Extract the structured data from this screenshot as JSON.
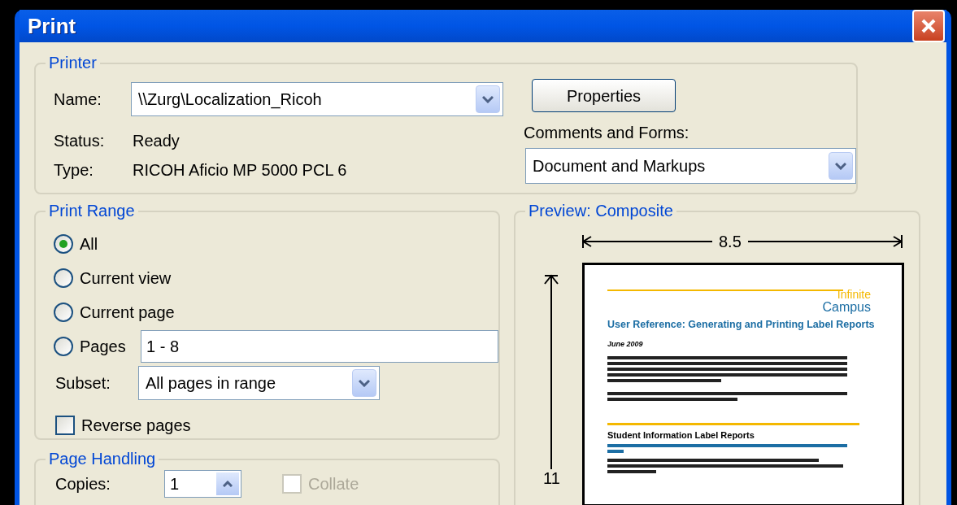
{
  "window": {
    "title": "Print"
  },
  "printer": {
    "legend": "Printer",
    "name_label": "Name:",
    "name_value": "\\\\Zurg\\Localization_Ricoh",
    "status_label": "Status:",
    "status_value": "Ready",
    "type_label": "Type:",
    "type_value": "RICOH Aficio MP 5000 PCL 6",
    "properties_button": "Properties",
    "comments_label": "Comments and Forms:",
    "comments_value": "Document and Markups"
  },
  "print_range": {
    "legend": "Print Range",
    "options": [
      {
        "label": "All",
        "selected": true
      },
      {
        "label": "Current view",
        "selected": false
      },
      {
        "label": "Current page",
        "selected": false
      },
      {
        "label": "Pages",
        "selected": false,
        "value": "1 - 8"
      }
    ],
    "subset_label": "Subset:",
    "subset_value": "All pages in range",
    "reverse": {
      "label": "Reverse pages",
      "checked": false
    }
  },
  "page_handling": {
    "legend": "Page Handling",
    "copies_label": "Copies:",
    "copies_value": "1",
    "collate": {
      "label": "Collate",
      "checked": false,
      "disabled": true
    }
  },
  "preview": {
    "legend": "Preview: Composite",
    "width_label": "8.5",
    "height_label": "11",
    "page": {
      "logo_top": "Infinite",
      "logo_bottom": "Campus",
      "title": "User Reference: Generating and Printing Label Reports",
      "date": "June 2009",
      "section_heading": "Student Information Label Reports"
    }
  }
}
